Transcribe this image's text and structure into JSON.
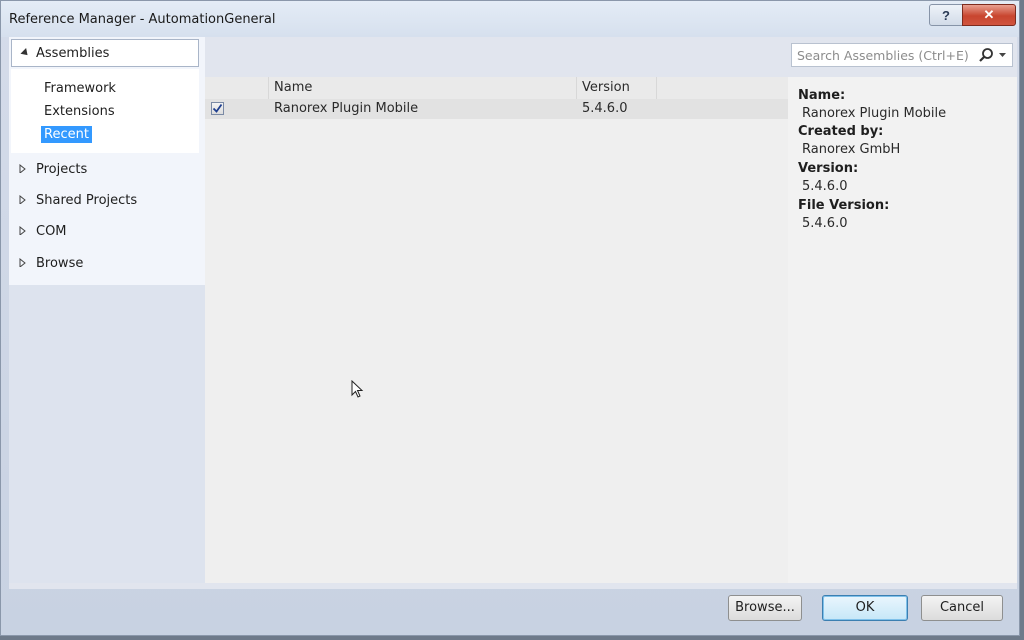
{
  "window": {
    "title": "Reference Manager - AutomationGeneral",
    "help_glyph": "?",
    "close_glyph": "✕"
  },
  "nav": {
    "assemblies": "Assemblies",
    "sub_items": [
      "Framework",
      "Extensions",
      "Recent"
    ],
    "selected_sub": "Recent",
    "groups": [
      "Projects",
      "Shared Projects",
      "COM",
      "Browse"
    ]
  },
  "search": {
    "placeholder": "Search Assemblies (Ctrl+E)"
  },
  "list": {
    "columns": [
      "Name",
      "Version"
    ],
    "rows": [
      {
        "checked": true,
        "name": "Ranorex Plugin Mobile",
        "version": "5.4.6.0"
      }
    ]
  },
  "details": {
    "name_label": "Name:",
    "name_value": "Ranorex Plugin Mobile",
    "created_label": "Created by:",
    "created_value": "Ranorex GmbH",
    "version_label": "Version:",
    "version_value": "5.4.6.0",
    "file_version_label": "File Version:",
    "file_version_value": "5.4.6.0"
  },
  "buttons": {
    "browse": "Browse...",
    "ok": "OK",
    "cancel": "Cancel"
  },
  "colors": {
    "selection": "#3399ff",
    "close_button": "#c8452f",
    "ok_border": "#3c7fb1"
  }
}
